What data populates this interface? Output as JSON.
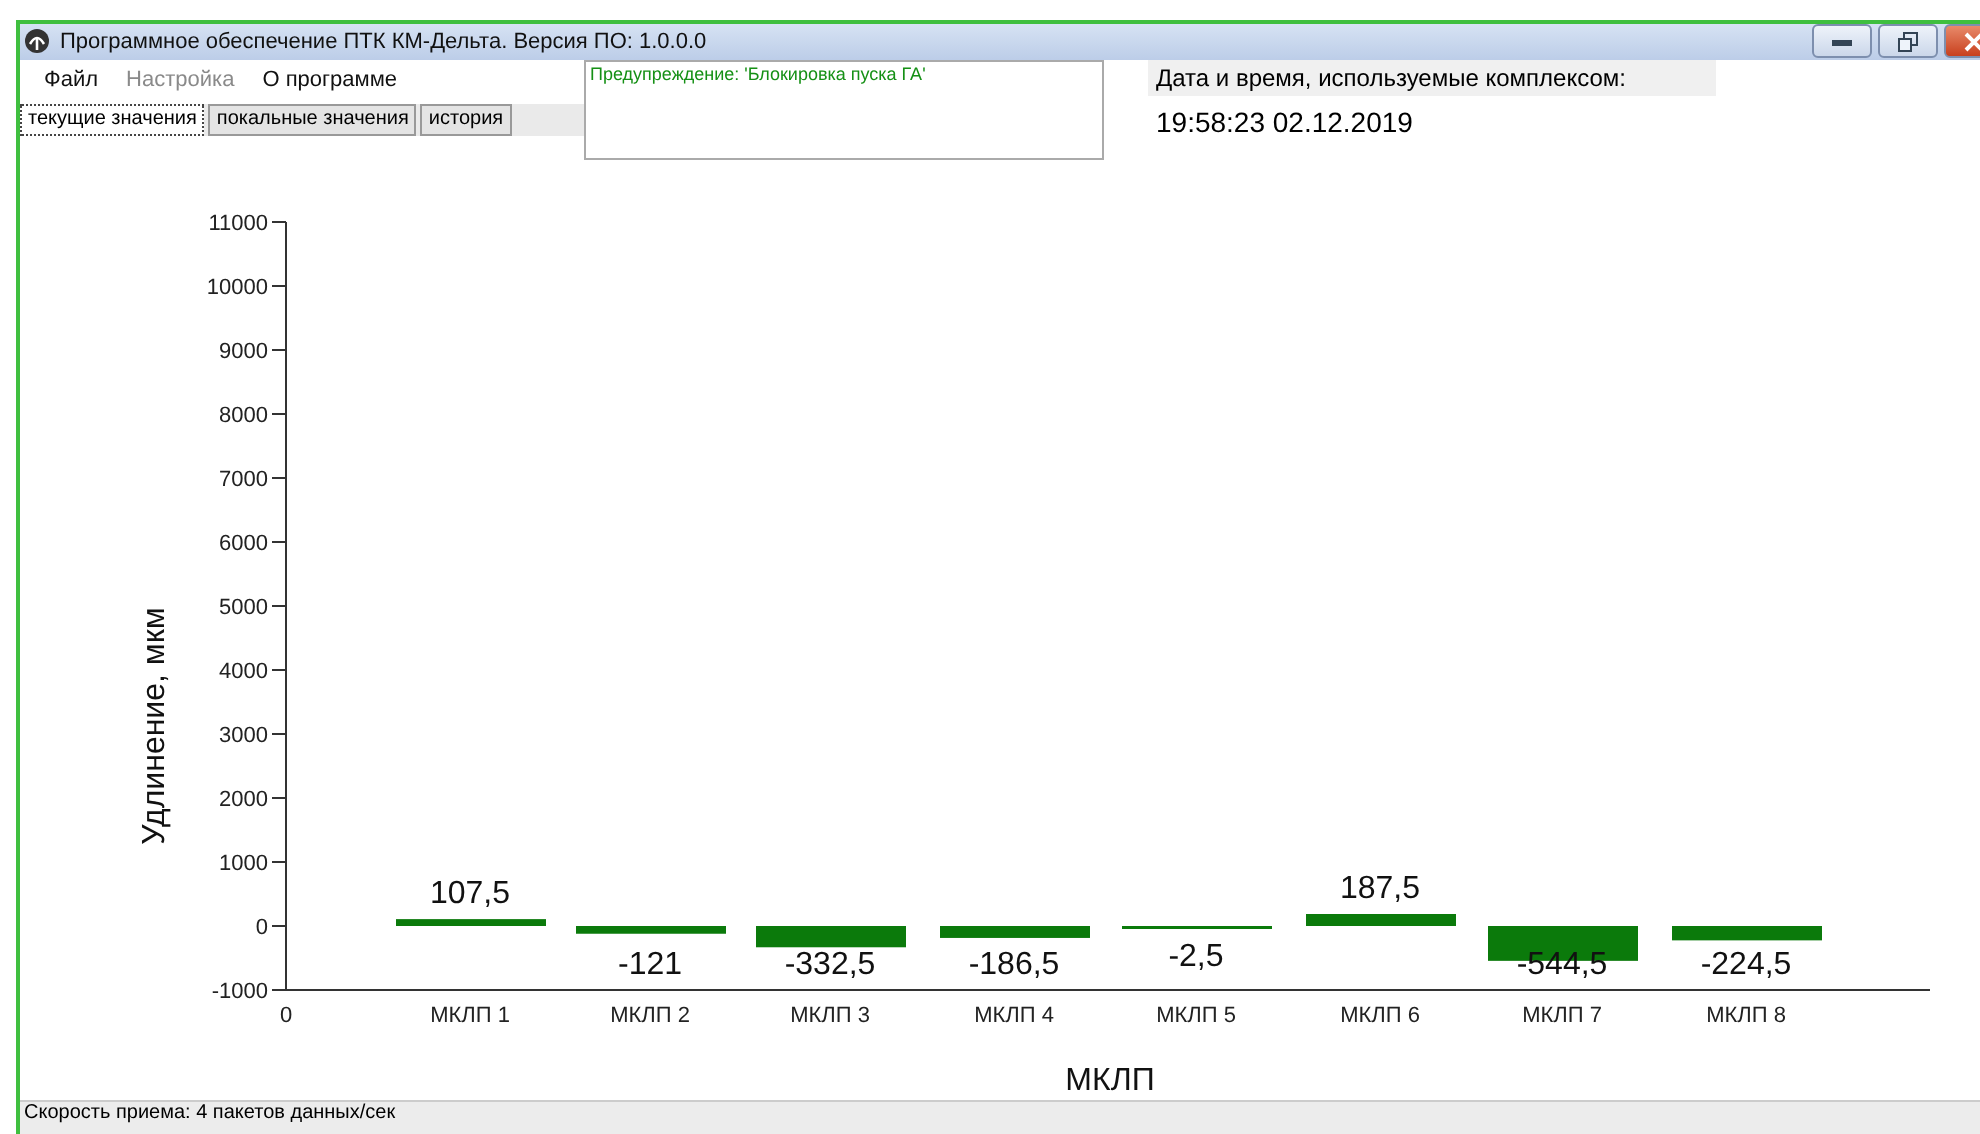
{
  "window": {
    "title": "Программное обеспечение ПТК КМ-Дельта. Версия ПО: 1.0.0.0"
  },
  "menu": [
    {
      "label": "Файл",
      "disabled": false
    },
    {
      "label": "Настройка",
      "disabled": true
    },
    {
      "label": "О программе",
      "disabled": false
    }
  ],
  "tabs": [
    {
      "label": "текущие значения",
      "selected": true
    },
    {
      "label": "покальные значения",
      "selected": false
    },
    {
      "label": "история",
      "selected": false
    }
  ],
  "warning": "Предупреждение: 'Блокировка пуска ГА'",
  "datetime": {
    "label": "Дата и время, используемые комплексом:",
    "value": "19:58:23 02.12.2019"
  },
  "chart": {
    "chart_data": {
      "type": "bar",
      "xlabel": "МКЛП",
      "ylabel": "Удлинение, мкм",
      "categories": [
        "МКЛП 1",
        "МКЛП 2",
        "МКЛП 3",
        "МКЛП 4",
        "МКЛП 5",
        "МКЛП 6",
        "МКЛП 7",
        "МКЛП 8"
      ],
      "series": [
        {
          "color": "#0b7a0b",
          "values": [
            107.5,
            -121,
            -332.5,
            -186.5,
            -2.5,
            187.5,
            -544.5,
            -224.5
          ]
        }
      ],
      "value_labels": [
        "107,5",
        "-121",
        "-332,5",
        "-186,5",
        "-2,5",
        "187,5",
        "-544,5",
        "-224,5"
      ],
      "ylim": [
        -1000,
        11000
      ],
      "yticks": [
        -1000,
        0,
        1000,
        2000,
        3000,
        4000,
        5000,
        6000,
        7000,
        8000,
        9000,
        10000,
        11000
      ]
    },
    "origin_label": "0"
  },
  "status_bar": "Скорость приема:  4  пакетов данных/сек"
}
